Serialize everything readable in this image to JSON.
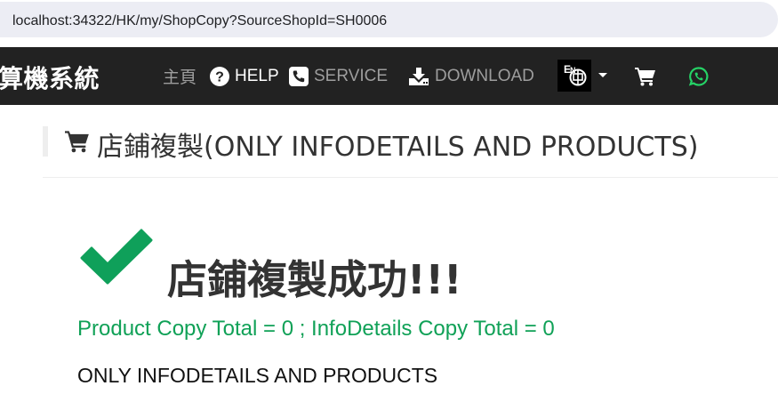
{
  "browser": {
    "url": "localhost:34322/HK/my/ShopCopy?SourceShopId=SH0006"
  },
  "navbar": {
    "brand": "算機系統",
    "home_label": "主頁",
    "help_label": "HELP",
    "service_label": "SERVICE",
    "download_label": "DOWNLOAD",
    "language_icon": "en-zh-language-icon",
    "cart_icon": "shopping-cart-icon",
    "whatsapp_icon": "whatsapp-icon",
    "background_color": "#222222",
    "whatsapp_color": "#25d366"
  },
  "page": {
    "title": "店鋪複製(ONLY INFODETAILS AND PRODUCTS)",
    "title_icon": "shopping-cart-icon"
  },
  "result": {
    "icon": "checkmark-icon",
    "icon_color": "#0fa05a",
    "heading": "店鋪複製成功!!!",
    "summary": "Product Copy Total = 0 ; InfoDetails Copy Total = 0",
    "summary_color": "#10a157",
    "mode": "ONLY INFODETAILS AND PRODUCTS"
  }
}
